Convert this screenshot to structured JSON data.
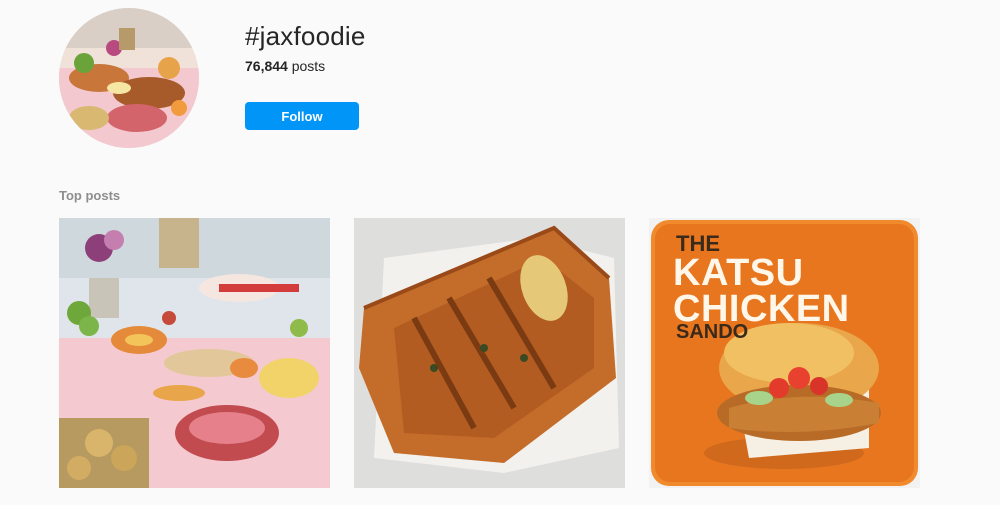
{
  "header": {
    "hashtag": "#jaxfoodie",
    "post_count": "76,844",
    "posts_label": "posts",
    "follow_label": "Follow"
  },
  "colors": {
    "follow_button": "#0095f6",
    "background": "#fafafa",
    "katsu_orange": "#e8761e"
  },
  "sections": {
    "top_posts_label": "Top posts"
  },
  "top_posts": [
    {
      "alt": "charcuterie grazing table"
    },
    {
      "alt": "puff pastry braid"
    },
    {
      "overlay": {
        "line_the": "THE",
        "line_1": "KATSU",
        "line_2": "CHICKEN",
        "line_sando": "SANDO"
      }
    }
  ]
}
